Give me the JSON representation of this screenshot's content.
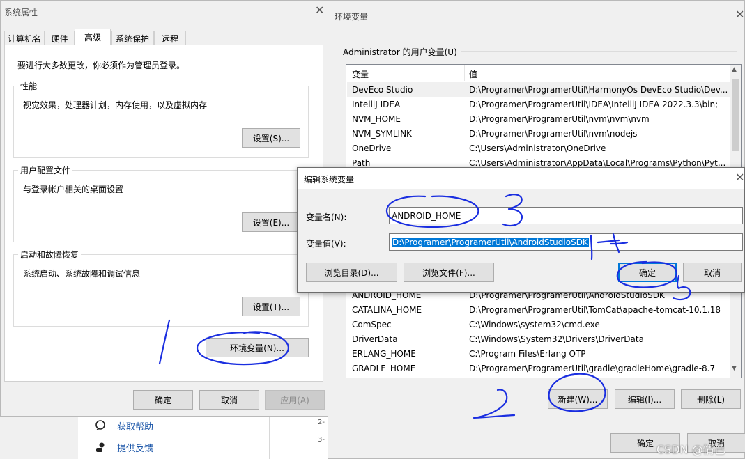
{
  "sys_props": {
    "title": "系统属性",
    "tabs": [
      "计算机名",
      "硬件",
      "高级",
      "系统保护",
      "远程"
    ],
    "admin_note": "要进行大多数更改，你必须作为管理员登录。",
    "perf": {
      "title": "性能",
      "desc": "视觉效果，处理器计划，内存使用，以及虚拟内存",
      "button": "设置(S)..."
    },
    "profile": {
      "title": "用户配置文件",
      "desc": "与登录帐户相关的桌面设置",
      "button": "设置(E)..."
    },
    "startup": {
      "title": "启动和故障恢复",
      "desc": "系统启动、系统故障和调试信息",
      "button": "设置(T)..."
    },
    "env_button": "环境变量(N)...",
    "ok": "确定",
    "cancel": "取消",
    "apply": "应用(A)"
  },
  "background": {
    "help": "获取帮助",
    "feedback": "提供反馈",
    "line1": "2-",
    "line2": "3-"
  },
  "env_vars": {
    "title": "环境变量",
    "user_section": "Administrator 的用户变量(U)",
    "col_var": "变量",
    "col_val": "值",
    "user_rows": [
      {
        "name": "DevEco Studio",
        "value": "D:\\Programer\\ProgramerUtil\\HarmonyOs DevEco Studio\\Dev..."
      },
      {
        "name": "IntelliJ IDEA",
        "value": "D:\\Programer\\ProgramerUtil\\IDEA\\IntelliJ IDEA 2022.3.3\\bin;"
      },
      {
        "name": "NVM_HOME",
        "value": "D:\\Programer\\ProgramerUtil\\nvm\\nvm\\nvm"
      },
      {
        "name": "NVM_SYMLINK",
        "value": "D:\\Programer\\ProgramerUtil\\nvm\\nodejs"
      },
      {
        "name": "OneDrive",
        "value": "C:\\Users\\Administrator\\OneDrive"
      },
      {
        "name": "Path",
        "value": "C:\\Users\\Administrator\\AppData\\Local\\Programs\\Python\\Pyt..."
      }
    ],
    "sys_rows": [
      {
        "name": "ANDROID_HOME",
        "value": "D:\\Programer\\ProgramerUtil\\AndroidStudioSDK"
      },
      {
        "name": "CATALINA_HOME",
        "value": "D:\\Programer\\ProgramerUtil\\TomCat\\apache-tomcat-10.1.18"
      },
      {
        "name": "ComSpec",
        "value": "C:\\Windows\\system32\\cmd.exe"
      },
      {
        "name": "DriverData",
        "value": "C:\\Windows\\System32\\Drivers\\DriverData"
      },
      {
        "name": "ERLANG_HOME",
        "value": "C:\\Program Files\\Erlang OTP"
      },
      {
        "name": "GRADLE_HOME",
        "value": "D:\\Programer\\ProgramerUtil\\gradle\\gradleHome\\gradle-8.7"
      }
    ],
    "new_button": "新建(W)...",
    "edit_button": "编辑(I)...",
    "delete_button": "删除(L)",
    "ok": "确定",
    "cancel": "取消"
  },
  "edit_dialog": {
    "title": "编辑系统变量",
    "name_label": "变量名(N):",
    "name_value": "ANDROID_HOME",
    "value_label": "变量值(V):",
    "value_value": "D:\\Programer\\ProgramerUtil\\AndroidStudioSDK",
    "browse_dir": "浏览目录(D)...",
    "browse_file": "浏览文件(F)...",
    "ok": "确定",
    "cancel": "取消"
  },
  "annotations": [
    "1",
    "2",
    "3",
    "4",
    "5"
  ],
  "watermark": "CSDN @情己",
  "colors": {
    "selection": "#0078d7",
    "annotation_ink": "#1a2ee0",
    "focus_border": "#0078d7"
  }
}
